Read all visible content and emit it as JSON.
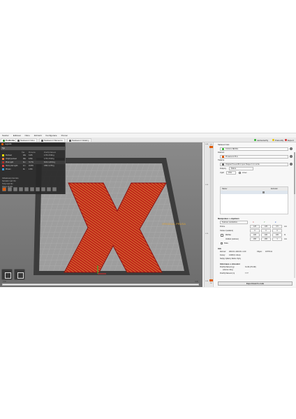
{
  "menu": [
    "Soubor",
    "Editovat",
    "Okno",
    "Zobrazit",
    "Konfigurace",
    "Pomoc"
  ],
  "tabs": [
    {
      "label": "Podložka",
      "icon": "plater-icon",
      "color": "#2b8a2b",
      "active": true
    },
    {
      "label": "Nastavení tisku",
      "icon": "print-settings-icon",
      "color": "#555555",
      "active": false
    },
    {
      "label": "Nastavení filamentu",
      "icon": "filament-settings-icon",
      "color": "#555555",
      "active": false
    },
    {
      "label": "Nastavení tiskárny",
      "icon": "printer-settings-icon",
      "color": "#555555",
      "active": false
    }
  ],
  "mode_buttons": [
    {
      "label": "Jednoduchý",
      "color": "#2bb52b"
    },
    {
      "label": "Pokročilý",
      "color": "#e6c400"
    },
    {
      "label": "Expert",
      "color": "#d62e2e"
    }
  ],
  "legend": {
    "title": "Legenda",
    "view_type": "Typ",
    "columns": [
      "Čas",
      "Procenta",
      "Použitý filament"
    ],
    "rows": [
      {
        "name": "Perimetr",
        "time": "18s",
        "percent": "3.2%",
        "filament": "1.70 m  5.01 g",
        "color": "#ffe600"
      },
      {
        "name": "Vnější perimetr",
        "time": "36s",
        "percent": "6.5%",
        "filament": "1.76 m  5.19 g",
        "color": "#ff7d38"
      },
      {
        "name": "Plná výplň",
        "time": "6m",
        "percent": "72.7%",
        "filament": "8.01 m  23.61 g",
        "color": "#b03029"
      },
      {
        "name": "Horní plná výplň",
        "time": "1m",
        "percent": "10.8%",
        "filament": "0.86 m  2.53 g",
        "color": "#f03c3c"
      },
      {
        "name": "Přesun",
        "time": "9s",
        "percent": "1.6%",
        "filament": "",
        "color": "#38a0e0"
      }
    ],
    "extra_title": "Odhadovaný čas tisku",
    "extra_rows": [
      "Normální mód",
      "Tichý mód",
      "Vrstva"
    ],
    "extra_values": [
      "8m",
      "8m",
      "9m16s"
    ]
  },
  "viewport": {
    "bed_logo": "ORIGINAL PRUSA",
    "slider_left_label": "0.00",
    "slider_right_label": "0.00",
    "ruler_values": [
      "0.60",
      "0.40",
      "0.20",
      "0.00"
    ]
  },
  "panel": {
    "printer_label": "Nastavení tisku",
    "print_profile": "0.10mm DETAIL",
    "filament_label": "Filament",
    "filament_profile": "Prusament PLA",
    "printer_section": "Tiskárna",
    "printer_profile": "Original Prusa MK4 Input Shaper 0.4 nozzle",
    "supports_label": "Podpěry",
    "supports_value": "Žádné",
    "infill_label": "Výplň",
    "infill_value": "15%",
    "brim_label": "Límec",
    "object_table": {
      "col_name": "Název",
      "col_extruder": "Extruder"
    },
    "manipulation_title": "Manipulace s objektem",
    "coord_system": "Světové souřadnice",
    "axes": [
      "X",
      "Y",
      "Z"
    ],
    "position_label": "Pozice",
    "position_values": [
      "125",
      "105",
      "0.5"
    ],
    "position_unit": "mm",
    "rotation_label": "Otočení (relativní)",
    "rotation_values": [
      "0",
      "0",
      "0"
    ],
    "scale_label": "Měřítko",
    "scale_values": [
      "100",
      "100",
      "100"
    ],
    "scale_unit": "%",
    "size_label": "Velikost (světové)",
    "size_values": [
      "200",
      "200",
      "1"
    ],
    "size_unit": "mm",
    "inches_label": "Palce",
    "info_title": "Info",
    "size_info_label": "Rozměr:",
    "size_info_value": "200.00 x 200.00 x 1.00",
    "volume_label": "Objem:",
    "volume_value": "19778.41",
    "facets_label": "Fazety:",
    "facets_value": "13406 (1 shiva)",
    "errors_label": "Nebyly zjištěny žádné chyby",
    "slice_info_title": "Informace o slicování",
    "filament_used_label": "Použitý filament (g)",
    "filament_used_value": "31.30 (274.38)",
    "filament_used_sub": "(včetně cívky)",
    "filament_m_label": "Použitý filament (m)",
    "filament_m_value": "7.77",
    "export_label": "Exportovat G-code"
  }
}
